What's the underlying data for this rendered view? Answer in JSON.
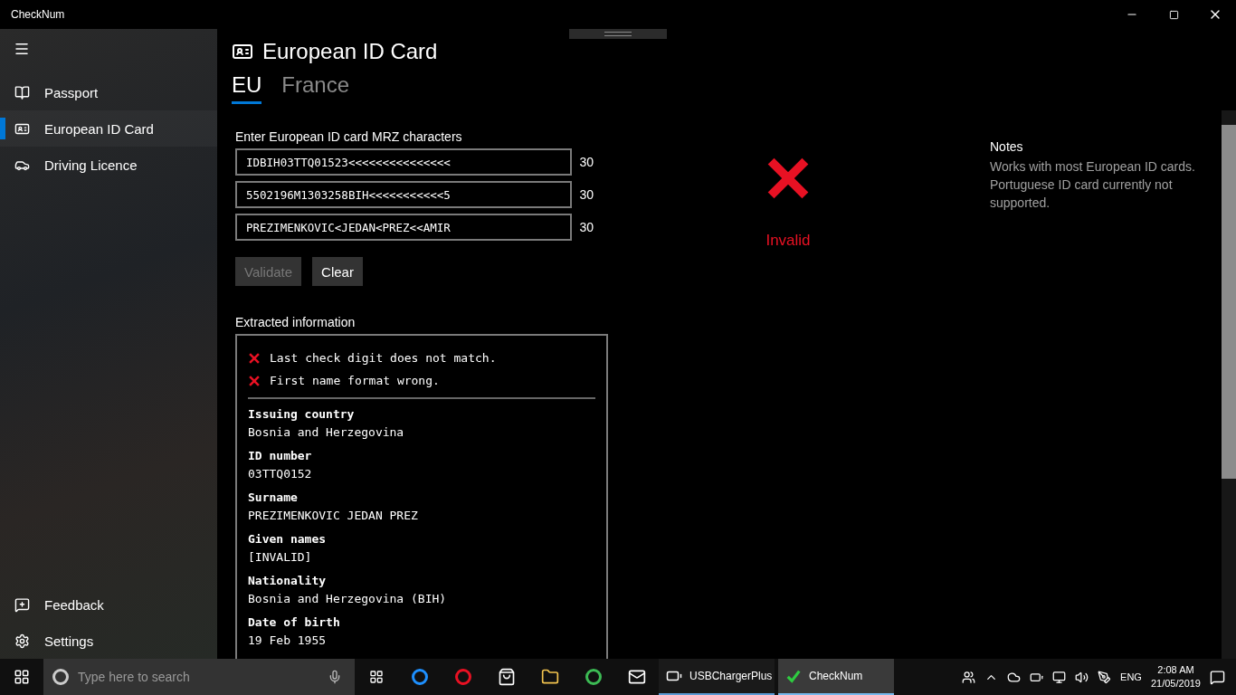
{
  "window": {
    "title": "CheckNum"
  },
  "sidebar": {
    "items": [
      {
        "label": "Passport",
        "selected": false
      },
      {
        "label": "European ID Card",
        "selected": true
      },
      {
        "label": "Driving Licence",
        "selected": false
      }
    ],
    "footer_items": [
      {
        "label": "Feedback"
      },
      {
        "label": "Settings"
      }
    ]
  },
  "page": {
    "title": "European ID Card",
    "tabs": [
      {
        "label": "EU",
        "selected": true
      },
      {
        "label": "France",
        "selected": false
      }
    ],
    "mrz": {
      "label": "Enter European ID card MRZ characters",
      "lines": [
        {
          "value": "IDBIH03TTQ01523<<<<<<<<<<<<<<<",
          "count": "30"
        },
        {
          "value": "5502196M1303258BIH<<<<<<<<<<<5",
          "count": "30"
        },
        {
          "value": "PREZIMENKOVIC<JEDAN<PREZ<<AMIR",
          "count": "30"
        }
      ]
    },
    "buttons": [
      {
        "label": "Validate",
        "disabled": true
      },
      {
        "label": "Clear",
        "disabled": false
      }
    ],
    "result": {
      "valid": false,
      "label": "Invalid"
    },
    "extracted": {
      "title": "Extracted information",
      "errors": [
        "Last check digit does not match.",
        "First name format wrong."
      ],
      "fields": [
        {
          "label": "Issuing country",
          "value": "Bosnia and Herzegovina"
        },
        {
          "label": "ID number",
          "value": "03TTQ0152"
        },
        {
          "label": "Surname",
          "value": "PREZIMENKOVIC JEDAN PREZ"
        },
        {
          "label": "Given names",
          "value": "[INVALID]"
        },
        {
          "label": "Nationality",
          "value": "Bosnia and Herzegovina (BIH)"
        },
        {
          "label": "Date of birth",
          "value": "19 Feb 1955"
        }
      ]
    },
    "notes": {
      "title": "Notes",
      "text": "Works with most European ID cards. Portuguese ID card currently not supported."
    }
  },
  "taskbar": {
    "search_placeholder": "Type here to search",
    "apps": [
      {
        "label": "USBChargerPlus",
        "active": false
      },
      {
        "label": "CheckNum",
        "active": true
      }
    ],
    "language": "ENG",
    "time": "2:08 AM",
    "date": "21/05/2019"
  }
}
